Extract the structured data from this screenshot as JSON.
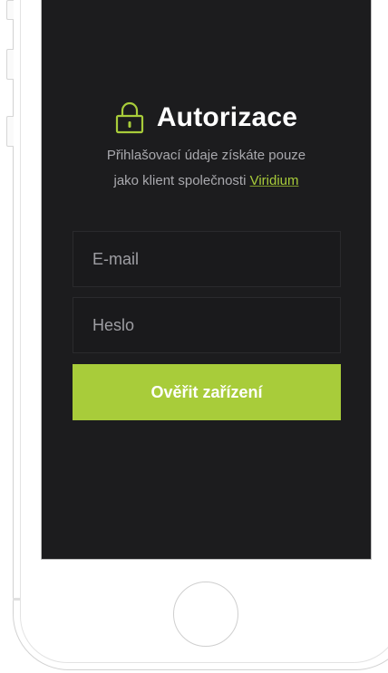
{
  "auth": {
    "title": "Autorizace",
    "subtitle_line1": "Přihlašovací údaje získáte pouze",
    "subtitle_line2_prefix": "jako klient společnosti ",
    "company_link": "Viridium",
    "email_placeholder": "E-mail",
    "password_placeholder": "Heslo",
    "submit_label": "Ověřit zařízení",
    "title_icon": "lock-icon"
  },
  "colors": {
    "accent": "#a8cc3a",
    "screen_background": "#1c1c1e",
    "title_text": "#ffffff",
    "muted_text": "#a9a9ae"
  }
}
